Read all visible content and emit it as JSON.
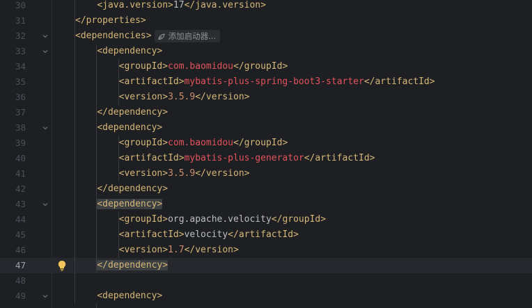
{
  "editor": {
    "current_line": 47,
    "colors": {
      "background": "#1e1f22",
      "tag": "#d5b778",
      "value_orange": "#cf8e6d",
      "value_red": "#e2535b",
      "text": "#bcbec4",
      "line_number": "#4b5059",
      "current_line_bg": "#26282e"
    },
    "inlay_hint": {
      "icon": "spark-icon",
      "label": "添加启动器..."
    },
    "intention_icon": "bulb-icon",
    "lines": [
      {
        "num": "30",
        "segs": [
          {
            "t": "<java.version>",
            "c": "tag"
          },
          {
            "t": "17",
            "c": "text"
          },
          {
            "t": "</java.version>",
            "c": "tag"
          }
        ]
      },
      {
        "num": "31",
        "segs": [
          {
            "t": "</properties>",
            "c": "tag"
          }
        ]
      },
      {
        "num": "32",
        "segs": [
          {
            "t": "<dependencies>",
            "c": "tag"
          }
        ]
      },
      {
        "num": "33",
        "segs": [
          {
            "t": "<dependency>",
            "c": "tag"
          }
        ]
      },
      {
        "num": "34",
        "segs": [
          {
            "t": "<groupId>",
            "c": "tag"
          },
          {
            "t": "com.baomidou",
            "c": "val-red"
          },
          {
            "t": "</groupId>",
            "c": "tag"
          }
        ]
      },
      {
        "num": "35",
        "segs": [
          {
            "t": "<artifactId>",
            "c": "tag"
          },
          {
            "t": "mybatis-plus-spring-boot3-starter",
            "c": "val-red"
          },
          {
            "t": "</artifactId>",
            "c": "tag"
          }
        ]
      },
      {
        "num": "36",
        "segs": [
          {
            "t": "<version>",
            "c": "tag"
          },
          {
            "t": "3.5.9",
            "c": "val"
          },
          {
            "t": "</version>",
            "c": "tag"
          }
        ]
      },
      {
        "num": "37",
        "segs": [
          {
            "t": "</dependency>",
            "c": "tag"
          }
        ]
      },
      {
        "num": "38",
        "segs": [
          {
            "t": "<dependency>",
            "c": "tag"
          }
        ]
      },
      {
        "num": "39",
        "segs": [
          {
            "t": "<groupId>",
            "c": "tag"
          },
          {
            "t": "com.baomidou",
            "c": "val-red"
          },
          {
            "t": "</groupId>",
            "c": "tag"
          }
        ]
      },
      {
        "num": "40",
        "segs": [
          {
            "t": "<artifactId>",
            "c": "tag"
          },
          {
            "t": "mybatis-plus-generator",
            "c": "val-red"
          },
          {
            "t": "</artifactId>",
            "c": "tag"
          }
        ]
      },
      {
        "num": "41",
        "segs": [
          {
            "t": "<version>",
            "c": "tag"
          },
          {
            "t": "3.5.9",
            "c": "val"
          },
          {
            "t": "</version>",
            "c": "tag"
          }
        ]
      },
      {
        "num": "42",
        "segs": [
          {
            "t": "</dependency>",
            "c": "tag"
          }
        ]
      },
      {
        "num": "43",
        "segs": [
          {
            "t": "<dependency>",
            "c": "tag",
            "hl": true
          }
        ]
      },
      {
        "num": "44",
        "segs": [
          {
            "t": "<groupId>",
            "c": "tag"
          },
          {
            "t": "org.apache.velocity",
            "c": "text"
          },
          {
            "t": "</groupId>",
            "c": "tag"
          }
        ]
      },
      {
        "num": "45",
        "segs": [
          {
            "t": "<artifactId>",
            "c": "tag"
          },
          {
            "t": "velocity",
            "c": "text"
          },
          {
            "t": "</artifactId>",
            "c": "tag"
          }
        ]
      },
      {
        "num": "46",
        "segs": [
          {
            "t": "<version>",
            "c": "tag"
          },
          {
            "t": "1.7",
            "c": "val"
          },
          {
            "t": "</version>",
            "c": "tag"
          }
        ]
      },
      {
        "num": "47",
        "segs": [
          {
            "t": "</dependency>",
            "c": "tag",
            "hl": true
          }
        ]
      },
      {
        "num": "48",
        "segs": []
      },
      {
        "num": "49",
        "segs": [
          {
            "t": "<dependency>",
            "c": "tag"
          }
        ]
      }
    ]
  }
}
